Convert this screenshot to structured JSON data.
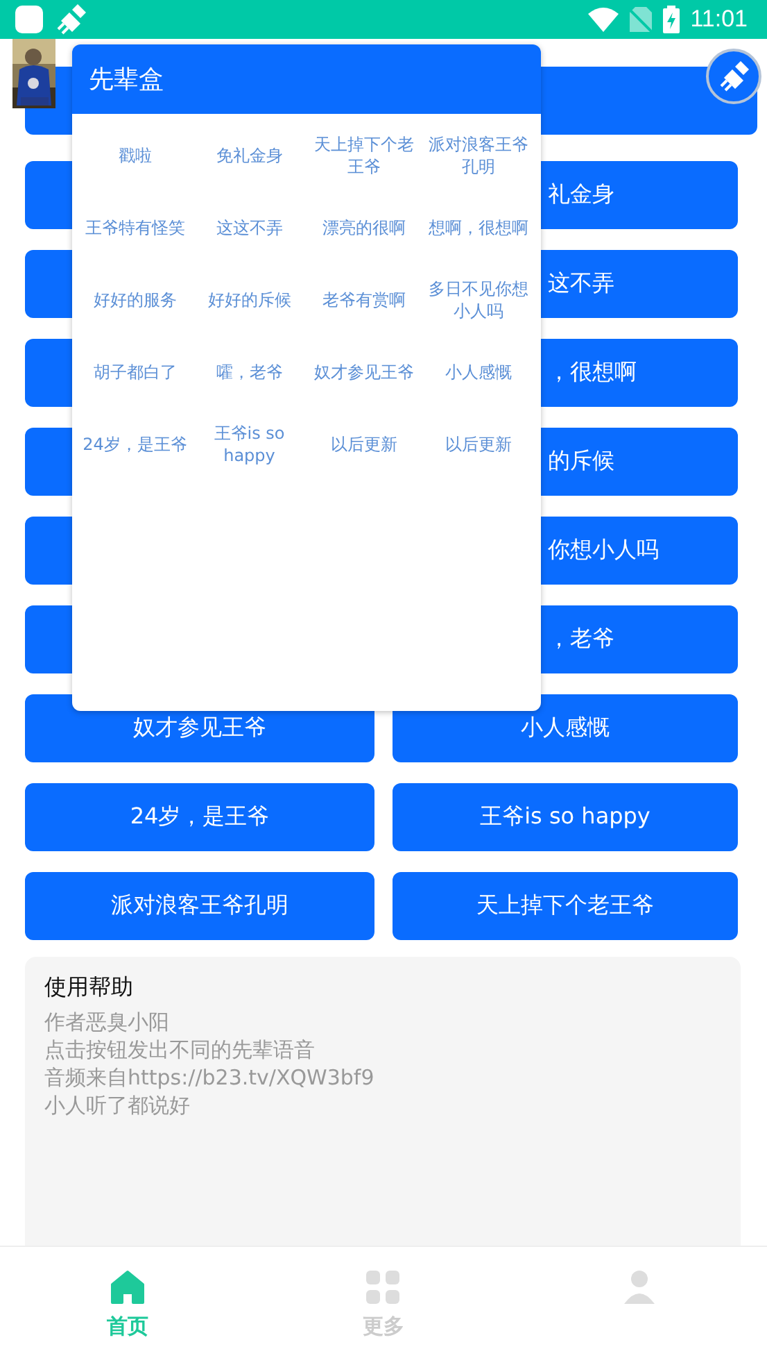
{
  "status_bar": {
    "time": "11:01"
  },
  "button_rows": [
    {
      "kind": "wide"
    },
    {
      "kind": "covered",
      "right": "礼金身"
    },
    {
      "kind": "covered",
      "right": "这不弄"
    },
    {
      "kind": "covered",
      "right": "，很想啊"
    },
    {
      "kind": "covered",
      "right": "的斥候"
    },
    {
      "kind": "covered",
      "right": "你想小人吗"
    },
    {
      "kind": "covered",
      "right": "，老爷"
    },
    {
      "kind": "full",
      "left": "奴才参见王爷",
      "right": "小人感慨"
    },
    {
      "kind": "full",
      "left": "24岁，是王爷",
      "right": "王爷is so happy"
    },
    {
      "kind": "full",
      "left": "派对浪客王爷孔明",
      "right": "天上掉下个老王爷"
    }
  ],
  "popup": {
    "title": "先辈盒",
    "items": [
      "戳啦",
      "免礼金身",
      "天上掉下个老王爷",
      "派对浪客王爷孔明",
      "王爷特有怪笑",
      "这这不弄",
      "漂亮的很啊",
      "想啊，很想啊",
      "好好的服务",
      "好好的斥候",
      "老爷有赏啊",
      "多日不见你想小人吗",
      "胡子都白了",
      "嚯，老爷",
      "奴才参见王爷",
      "小人感慨",
      "24岁，是王爷",
      "王爷is so happy",
      "以后更新",
      "以后更新"
    ]
  },
  "help": {
    "title": "使用帮助",
    "lines": [
      "作者恶臭小阳",
      "点击按钮发出不同的先辈语音",
      "音频来自https://b23.tv/XQW3bf9",
      "小人听了都说好"
    ]
  },
  "tabs": [
    {
      "kind": "home",
      "label": "首页",
      "selected": true
    },
    {
      "kind": "grid",
      "label": "更多",
      "selected": false
    },
    {
      "kind": "person",
      "selected": false
    }
  ]
}
